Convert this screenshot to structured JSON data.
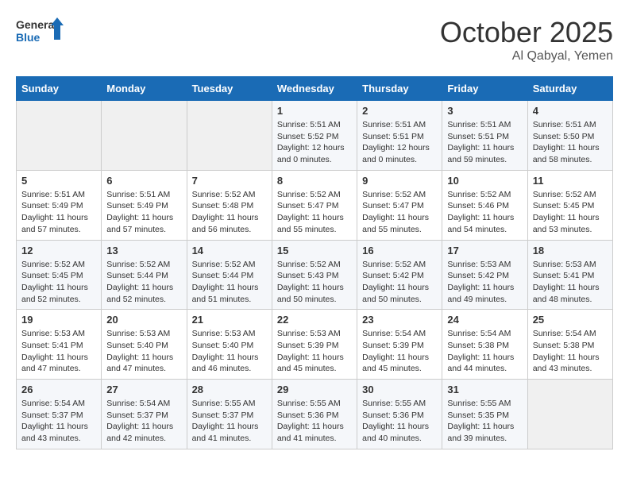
{
  "header": {
    "logo_line1": "General",
    "logo_line2": "Blue",
    "month": "October 2025",
    "location": "Al Qabyal, Yemen"
  },
  "weekdays": [
    "Sunday",
    "Monday",
    "Tuesday",
    "Wednesday",
    "Thursday",
    "Friday",
    "Saturday"
  ],
  "weeks": [
    [
      {
        "day": "",
        "info": ""
      },
      {
        "day": "",
        "info": ""
      },
      {
        "day": "",
        "info": ""
      },
      {
        "day": "1",
        "info": "Sunrise: 5:51 AM\nSunset: 5:52 PM\nDaylight: 12 hours\nand 0 minutes."
      },
      {
        "day": "2",
        "info": "Sunrise: 5:51 AM\nSunset: 5:51 PM\nDaylight: 12 hours\nand 0 minutes."
      },
      {
        "day": "3",
        "info": "Sunrise: 5:51 AM\nSunset: 5:51 PM\nDaylight: 11 hours\nand 59 minutes."
      },
      {
        "day": "4",
        "info": "Sunrise: 5:51 AM\nSunset: 5:50 PM\nDaylight: 11 hours\nand 58 minutes."
      }
    ],
    [
      {
        "day": "5",
        "info": "Sunrise: 5:51 AM\nSunset: 5:49 PM\nDaylight: 11 hours\nand 57 minutes."
      },
      {
        "day": "6",
        "info": "Sunrise: 5:51 AM\nSunset: 5:49 PM\nDaylight: 11 hours\nand 57 minutes."
      },
      {
        "day": "7",
        "info": "Sunrise: 5:52 AM\nSunset: 5:48 PM\nDaylight: 11 hours\nand 56 minutes."
      },
      {
        "day": "8",
        "info": "Sunrise: 5:52 AM\nSunset: 5:47 PM\nDaylight: 11 hours\nand 55 minutes."
      },
      {
        "day": "9",
        "info": "Sunrise: 5:52 AM\nSunset: 5:47 PM\nDaylight: 11 hours\nand 55 minutes."
      },
      {
        "day": "10",
        "info": "Sunrise: 5:52 AM\nSunset: 5:46 PM\nDaylight: 11 hours\nand 54 minutes."
      },
      {
        "day": "11",
        "info": "Sunrise: 5:52 AM\nSunset: 5:45 PM\nDaylight: 11 hours\nand 53 minutes."
      }
    ],
    [
      {
        "day": "12",
        "info": "Sunrise: 5:52 AM\nSunset: 5:45 PM\nDaylight: 11 hours\nand 52 minutes."
      },
      {
        "day": "13",
        "info": "Sunrise: 5:52 AM\nSunset: 5:44 PM\nDaylight: 11 hours\nand 52 minutes."
      },
      {
        "day": "14",
        "info": "Sunrise: 5:52 AM\nSunset: 5:44 PM\nDaylight: 11 hours\nand 51 minutes."
      },
      {
        "day": "15",
        "info": "Sunrise: 5:52 AM\nSunset: 5:43 PM\nDaylight: 11 hours\nand 50 minutes."
      },
      {
        "day": "16",
        "info": "Sunrise: 5:52 AM\nSunset: 5:42 PM\nDaylight: 11 hours\nand 50 minutes."
      },
      {
        "day": "17",
        "info": "Sunrise: 5:53 AM\nSunset: 5:42 PM\nDaylight: 11 hours\nand 49 minutes."
      },
      {
        "day": "18",
        "info": "Sunrise: 5:53 AM\nSunset: 5:41 PM\nDaylight: 11 hours\nand 48 minutes."
      }
    ],
    [
      {
        "day": "19",
        "info": "Sunrise: 5:53 AM\nSunset: 5:41 PM\nDaylight: 11 hours\nand 47 minutes."
      },
      {
        "day": "20",
        "info": "Sunrise: 5:53 AM\nSunset: 5:40 PM\nDaylight: 11 hours\nand 47 minutes."
      },
      {
        "day": "21",
        "info": "Sunrise: 5:53 AM\nSunset: 5:40 PM\nDaylight: 11 hours\nand 46 minutes."
      },
      {
        "day": "22",
        "info": "Sunrise: 5:53 AM\nSunset: 5:39 PM\nDaylight: 11 hours\nand 45 minutes."
      },
      {
        "day": "23",
        "info": "Sunrise: 5:54 AM\nSunset: 5:39 PM\nDaylight: 11 hours\nand 45 minutes."
      },
      {
        "day": "24",
        "info": "Sunrise: 5:54 AM\nSunset: 5:38 PM\nDaylight: 11 hours\nand 44 minutes."
      },
      {
        "day": "25",
        "info": "Sunrise: 5:54 AM\nSunset: 5:38 PM\nDaylight: 11 hours\nand 43 minutes."
      }
    ],
    [
      {
        "day": "26",
        "info": "Sunrise: 5:54 AM\nSunset: 5:37 PM\nDaylight: 11 hours\nand 43 minutes."
      },
      {
        "day": "27",
        "info": "Sunrise: 5:54 AM\nSunset: 5:37 PM\nDaylight: 11 hours\nand 42 minutes."
      },
      {
        "day": "28",
        "info": "Sunrise: 5:55 AM\nSunset: 5:37 PM\nDaylight: 11 hours\nand 41 minutes."
      },
      {
        "day": "29",
        "info": "Sunrise: 5:55 AM\nSunset: 5:36 PM\nDaylight: 11 hours\nand 41 minutes."
      },
      {
        "day": "30",
        "info": "Sunrise: 5:55 AM\nSunset: 5:36 PM\nDaylight: 11 hours\nand 40 minutes."
      },
      {
        "day": "31",
        "info": "Sunrise: 5:55 AM\nSunset: 5:35 PM\nDaylight: 11 hours\nand 39 minutes."
      },
      {
        "day": "",
        "info": ""
      }
    ]
  ]
}
